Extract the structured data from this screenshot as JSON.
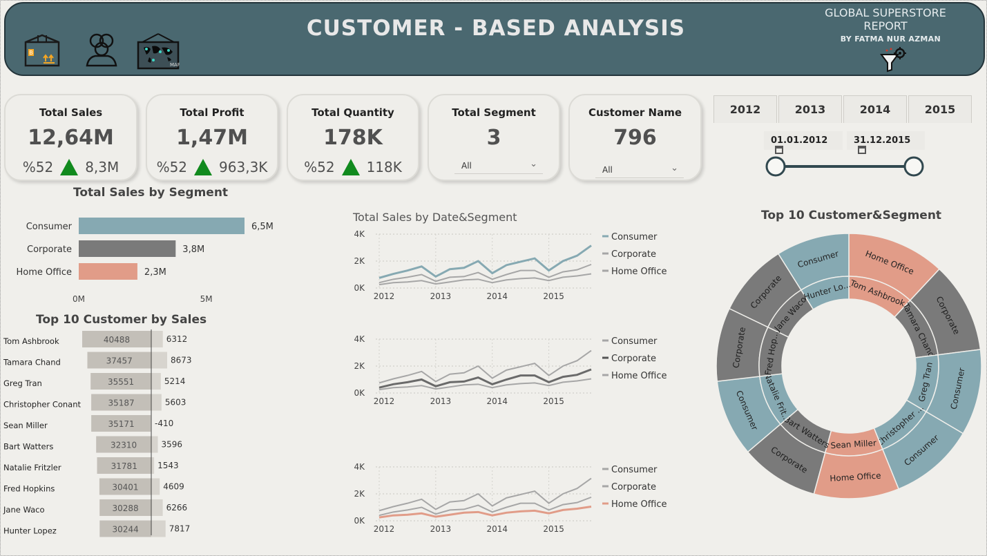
{
  "header": {
    "title": "CUSTOMER - BASED ANALYSIS",
    "report_title_1": "GLOBAL SUPERSTORE",
    "report_title_2": "REPORT",
    "author": "BY FATMA NUR AZMAN",
    "nav_icons": [
      "package-icon",
      "customers-icon",
      "world-map-icon"
    ],
    "map_icon_caption": "MAP",
    "package_icon_label": "B"
  },
  "kpis": {
    "sales": {
      "label": "Total Sales",
      "value": "12,64M",
      "pct": "%52",
      "delta": "8,3M"
    },
    "profit": {
      "label": "Total Profit",
      "value": "1,47M",
      "pct": "%52",
      "delta": "963,3K"
    },
    "quantity": {
      "label": "Total Quantity",
      "value": "178K",
      "pct": "%52",
      "delta": "118K"
    },
    "segment": {
      "label": "Total Segment",
      "value": "3",
      "filter": "All"
    },
    "customer": {
      "label": "Customer Name",
      "value": "796",
      "filter": "All"
    }
  },
  "date_filter": {
    "years": [
      "2012",
      "2013",
      "2014",
      "2015"
    ],
    "start": "01.01.2012",
    "end": "31.12.2015",
    "range": [
      0,
      1
    ]
  },
  "colors": {
    "consumer": "#86a9b2",
    "corporate": "#7a7a7a",
    "home_office": "#e19c88",
    "grey_line": "#a6a6a6",
    "header": "#4a6870",
    "up": "#118a1e"
  },
  "segment_chart": {
    "title": "Total Sales by Segment",
    "ticks": [
      "0M",
      "5M"
    ],
    "labels": [
      "6,5M",
      "3,8M",
      "2,3M"
    ]
  },
  "top10": {
    "title": "Top 10 Customer by Sales",
    "rows": [
      {
        "name": "Tom Ashbrook",
        "sales": "40488",
        "profit": "6312"
      },
      {
        "name": "Tamara Chand",
        "sales": "37457",
        "profit": "8673"
      },
      {
        "name": "Greg Tran",
        "sales": "35551",
        "profit": "5214"
      },
      {
        "name": "Christopher Conant",
        "sales": "35187",
        "profit": "5603"
      },
      {
        "name": "Sean Miller",
        "sales": "35171",
        "profit": "-410"
      },
      {
        "name": "Bart Watters",
        "sales": "32310",
        "profit": "3596"
      },
      {
        "name": "Natalie Fritzler",
        "sales": "31781",
        "profit": "1543"
      },
      {
        "name": "Fred Hopkins",
        "sales": "30401",
        "profit": "4609"
      },
      {
        "name": "Jane Waco",
        "sales": "30288",
        "profit": "6266"
      },
      {
        "name": "Hunter Lopez",
        "sales": "30244",
        "profit": "7817"
      }
    ]
  },
  "line_charts": {
    "title": "Total Sales by Date&Segment",
    "legend": [
      "Consumer",
      "Corporate",
      "Home Office"
    ],
    "y_ticks": [
      "4K",
      "2K",
      "0K"
    ],
    "x_ticks": [
      "2012",
      "2013",
      "2014",
      "2015"
    ]
  },
  "sunburst": {
    "title": "Top 10 Customer&Segment",
    "outer": [
      "Home Office",
      "Corporate",
      "Consumer",
      "Consumer",
      "Home Office",
      "Corporate",
      "Consumer",
      "Corporate",
      "Corporate",
      "Consumer"
    ],
    "inner": [
      "Tom Ashbrook",
      "Tamara Chand",
      "Greg Tran",
      "Christopher ...",
      "Sean Miller",
      "Bart Watters",
      "Natalie Frit...",
      "Fred Hop...",
      "Jane Waco",
      "Hunter Lo..."
    ]
  },
  "chart_data": [
    {
      "type": "bar",
      "title": "Total Sales by Segment",
      "categories": [
        "Consumer",
        "Corporate",
        "Home Office"
      ],
      "values": [
        6.5,
        3.8,
        2.3
      ],
      "unit": "M",
      "xlim": [
        0,
        6.5
      ],
      "colors": [
        "#86a9b2",
        "#7a7a7a",
        "#e19c88"
      ]
    },
    {
      "type": "bar",
      "title": "Top 10 Customer by Sales",
      "categories": [
        "Tom Ashbrook",
        "Tamara Chand",
        "Greg Tran",
        "Christopher Conant",
        "Sean Miller",
        "Bart Watters",
        "Natalie Fritzler",
        "Fred Hopkins",
        "Jane Waco",
        "Hunter Lopez"
      ],
      "series": [
        {
          "name": "Sales",
          "values": [
            40488,
            37457,
            35551,
            35187,
            35171,
            32310,
            31781,
            30401,
            30288,
            30244
          ]
        },
        {
          "name": "Profit",
          "values": [
            6312,
            8673,
            5214,
            5603,
            -410,
            3596,
            1543,
            4609,
            6266,
            7817
          ]
        }
      ]
    },
    {
      "type": "line",
      "title": "Total Sales by Date&Segment",
      "x": [
        "2012-Q1",
        "2012-Q2",
        "2012-Q3",
        "2012-Q4",
        "2013-Q1",
        "2013-Q2",
        "2013-Q3",
        "2013-Q4",
        "2014-Q1",
        "2014-Q2",
        "2014-Q3",
        "2014-Q4",
        "2015-Q1",
        "2015-Q2",
        "2015-Q3",
        "2015-Q4"
      ],
      "ylim": [
        0,
        4000
      ],
      "series": [
        {
          "name": "Consumer",
          "values": [
            750,
            1050,
            1300,
            1600,
            850,
            1400,
            1500,
            2000,
            1100,
            1700,
            1950,
            2200,
            1300,
            2000,
            2400,
            3150
          ]
        },
        {
          "name": "Corporate",
          "values": [
            400,
            650,
            800,
            1000,
            500,
            800,
            850,
            1150,
            650,
            1000,
            1300,
            1300,
            800,
            1200,
            1350,
            1750
          ]
        },
        {
          "name": "Home Office",
          "values": [
            250,
            400,
            450,
            550,
            300,
            450,
            600,
            650,
            400,
            600,
            700,
            750,
            550,
            800,
            900,
            1050
          ]
        }
      ]
    },
    {
      "type": "pie",
      "title": "Top 10 Customer&Segment",
      "categories": [
        "Tom Ashbrook",
        "Tamara Chand",
        "Greg Tran",
        "Christopher Conant",
        "Sean Miller",
        "Bart Watters",
        "Natalie Fritzler",
        "Fred Hopkins",
        "Jane Waco",
        "Hunter Lopez"
      ],
      "values": [
        40488,
        37457,
        35551,
        35187,
        35171,
        32310,
        31781,
        30401,
        30288,
        30244
      ]
    }
  ]
}
